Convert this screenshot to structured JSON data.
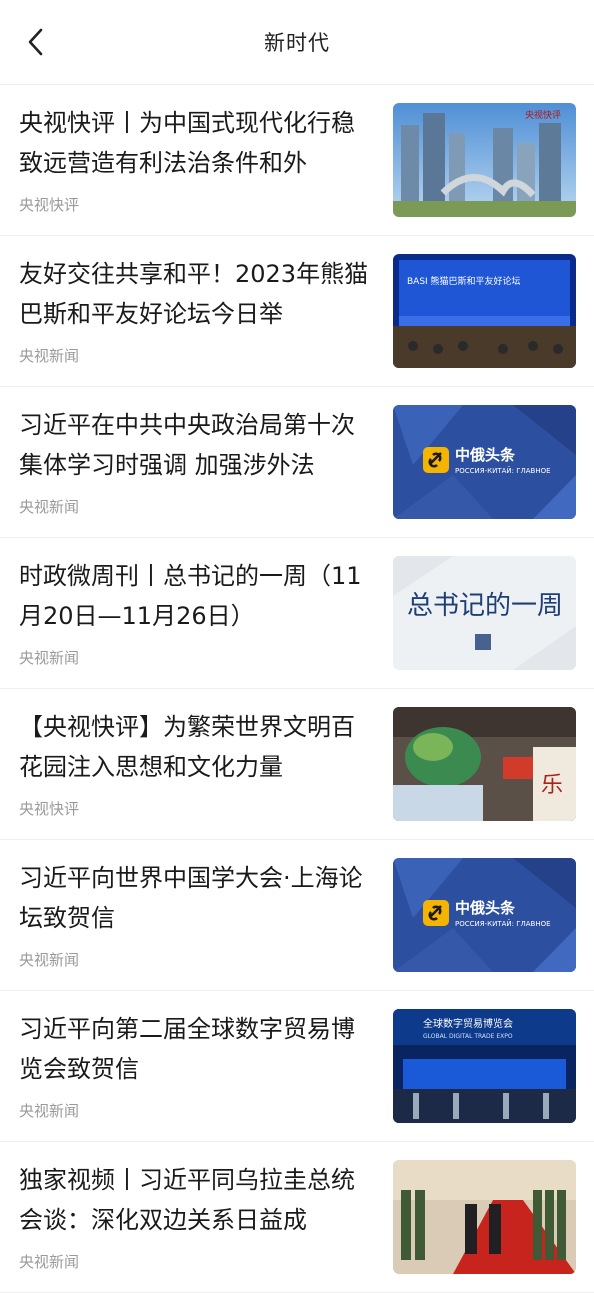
{
  "header": {
    "title": "新时代"
  },
  "articles": [
    {
      "headline": "央视快评丨为中国式现代化行稳致远营造有利法治条件和外",
      "source": "央视快评",
      "thumb_text": "央视快评"
    },
    {
      "headline": "友好交往共享和平！2023年熊猫巴斯和平友好论坛今日举",
      "source": "央视新闻",
      "thumb_text": "BASI 熊猫巴斯和平友好论坛"
    },
    {
      "headline": "习近平在中共中央政治局第十次集体学习时强调 加强涉外法",
      "source": "央视新闻",
      "thumb_text": "中俄头条",
      "thumb_sub": "РОССИЯ-КИТАЙ: ГЛАВНОЕ"
    },
    {
      "headline": "时政微周刊丨总书记的一周（11月20日—11月26日）",
      "source": "央视新闻",
      "thumb_text": "总书记的一周"
    },
    {
      "headline": "【央视快评】为繁荣世界文明百花园注入思想和文化力量",
      "source": "央视快评",
      "thumb_text": ""
    },
    {
      "headline": "习近平向世界中国学大会·上海论坛致贺信",
      "source": "央视新闻",
      "thumb_text": "中俄头条",
      "thumb_sub": "РОССИЯ-КИТАЙ: ГЛАВНОЕ"
    },
    {
      "headline": "习近平向第二届全球数字贸易博览会致贺信",
      "source": "央视新闻",
      "thumb_text": "全球数字贸易博览会",
      "thumb_sub": "GLOBAL DIGITAL TRADE EXPO"
    },
    {
      "headline": "独家视频丨习近平同乌拉圭总统会谈：深化双边关系日益成",
      "source": "央视新闻",
      "thumb_text": ""
    }
  ]
}
